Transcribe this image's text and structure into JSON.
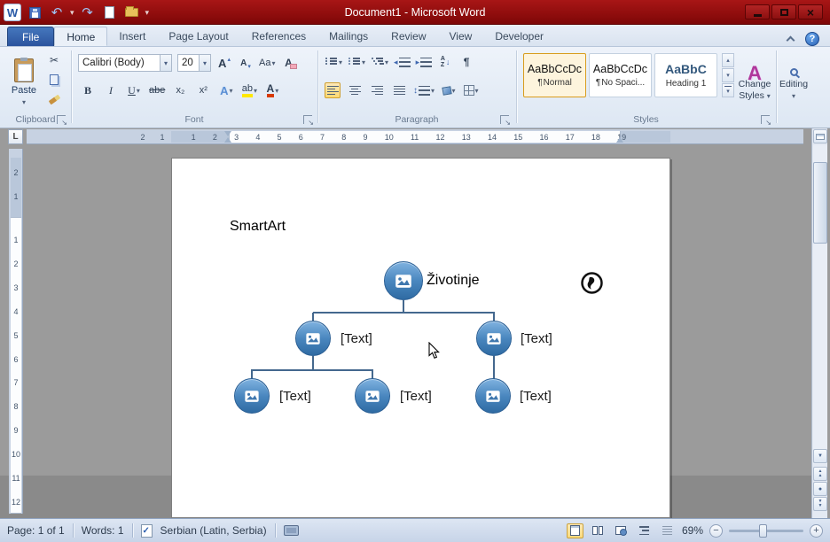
{
  "window": {
    "title": "Document1 - Microsoft Word"
  },
  "icons": {
    "word": "W",
    "dropdown": "▾",
    "up_small": "▴",
    "undo": "↶",
    "redo": "↷",
    "scissors": "✂",
    "pilcrow": "¶",
    "close": "×",
    "help": "?",
    "minus": "−",
    "plus": "+",
    "up_arrow": "▲",
    "down_arrow": "▼",
    "dot": "●",
    "arrow_down": "↓",
    "updown": "↕",
    "left_tri": "◂",
    "right_tri": "▸"
  },
  "ribbon_tabs": [
    "File",
    "Home",
    "Insert",
    "Page Layout",
    "References",
    "Mailings",
    "Review",
    "View",
    "Developer"
  ],
  "clipboard": {
    "group_label": "Clipboard",
    "paste_label": "Paste"
  },
  "font": {
    "group_label": "Font",
    "name": "Calibri (Body)",
    "size": "20",
    "grow": "A",
    "shrink": "A",
    "case": "Aa",
    "clear": "A",
    "bold": "B",
    "italic": "I",
    "underline": "U",
    "strike": "abe",
    "subscript": "x₂",
    "superscript": "x²",
    "effects": "A",
    "highlight": "ab",
    "color": "A"
  },
  "paragraph": {
    "group_label": "Paragraph",
    "sort_a": "A",
    "sort_z": "Z"
  },
  "styles": {
    "group_label": "Styles",
    "items": [
      {
        "preview": "AaBbCcDc",
        "name": "Normal"
      },
      {
        "preview": "AaBbCcDc",
        "name": "No Spaci..."
      },
      {
        "preview": "AaBbC",
        "name": "Heading 1"
      }
    ],
    "change_icon": "A",
    "change_line1": "Change",
    "change_line2": "Styles"
  },
  "editing": {
    "label": "Editing"
  },
  "ruler": {
    "h_margin": [
      "2",
      "1"
    ],
    "h_numbers": [
      "1",
      "2",
      "3",
      "4",
      "5",
      "6",
      "7",
      "8",
      "9",
      "10",
      "11",
      "12",
      "13",
      "14",
      "15",
      "16",
      "17",
      "18",
      "19"
    ],
    "v_margin": [
      "2",
      "1"
    ],
    "v_numbers": [
      "1",
      "2",
      "3",
      "4",
      "5",
      "6",
      "7",
      "8",
      "9",
      "10",
      "11",
      "12"
    ]
  },
  "document": {
    "heading": "SmartArt",
    "smartart": {
      "nodes": [
        {
          "label": "Životinje"
        },
        {
          "label": "[Text]"
        },
        {
          "label": "[Text]"
        },
        {
          "label": "[Text]"
        },
        {
          "label": "[Text]"
        },
        {
          "label": "[Text]"
        }
      ]
    }
  },
  "status": {
    "page": "Page: 1 of 1",
    "words": "Words: 1",
    "language": "Serbian (Latin, Serbia)",
    "zoom": "69%"
  }
}
